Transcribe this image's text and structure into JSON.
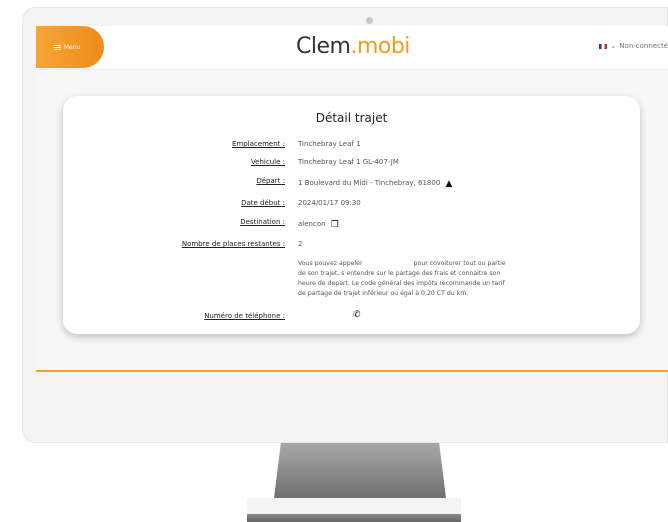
{
  "header": {
    "menu_label": "Menu",
    "logo_part1": "Clem",
    "logo_part2": ".mobi",
    "language_status": "Non-connecté"
  },
  "card": {
    "title": "Détail trajet",
    "rows": [
      {
        "label": "Emplacement :",
        "value": "Tinchebray Leaf 1"
      },
      {
        "label": "Vehicule :",
        "value": "Tinchebray Leaf 1 GL-407-JM"
      },
      {
        "label": "Départ :",
        "value": "1 Boulevard du Midi - Tinchebray, 61800"
      },
      {
        "label": "Date début :",
        "value": "2024/01/17 09:30"
      },
      {
        "label": "Destination :",
        "value": "alencon"
      },
      {
        "label": "Nombre de places restantes :",
        "value": "2"
      },
      {
        "label": "Numéro de téléphone :",
        "value": ""
      }
    ],
    "description_line1": "Vous pouvez appeler                          pour covoiturer tout ou partie",
    "description_line2": "de son trajet, s entendre sur le partage des frais et connaitre son",
    "description_line3": "heure de depart. Le code général des impôts recommande un tarif",
    "description_line4": "de partage de trajet inférieur ou égal à 0,20 CT du km."
  },
  "icons": {
    "menu": "menu-icon",
    "depart": "navigation-arrow-icon",
    "destination": "copy-icon",
    "phone": "phone-icon"
  },
  "colors": {
    "accent": "#f39a23",
    "menu_gradient_start": "#f7a637",
    "menu_gradient_end": "#f08a1c"
  }
}
